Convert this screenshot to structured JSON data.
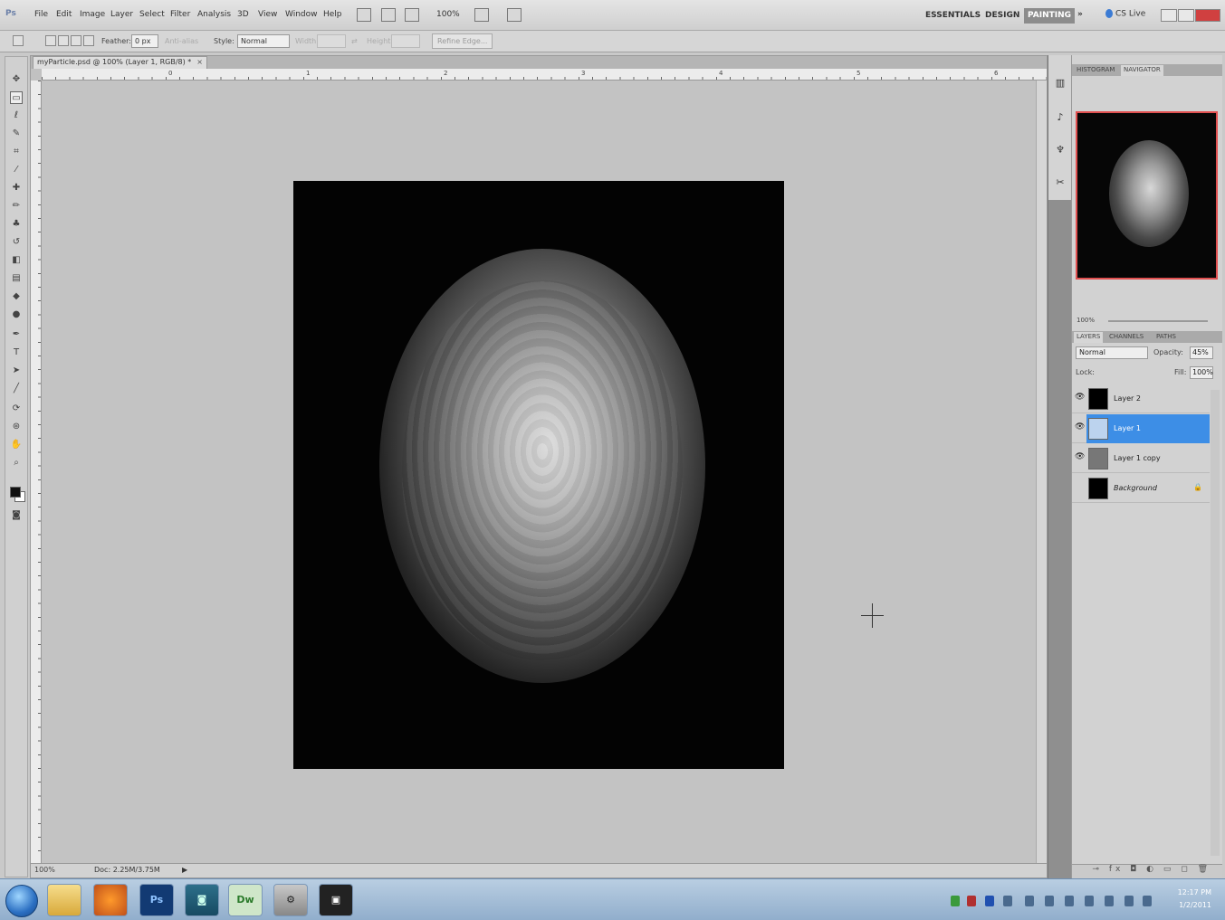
{
  "app": {
    "logo": "Ps",
    "menus": [
      "File",
      "Edit",
      "Image",
      "Layer",
      "Select",
      "Filter",
      "Analysis",
      "3D",
      "View",
      "Window",
      "Help"
    ],
    "zoom_menu": "100%",
    "workspaces": [
      "ESSENTIALS",
      "DESIGN",
      "PAINTING"
    ],
    "active_workspace": "PAINTING",
    "more": "»",
    "cs_live": "CS Live"
  },
  "options": {
    "feather_label": "Feather:",
    "feather_value": "0 px",
    "antialias_label": "Anti-alias",
    "style_label": "Style:",
    "style_value": "Normal",
    "width_label": "Width:",
    "height_label": "Height:",
    "refine_edge": "Refine Edge..."
  },
  "document": {
    "tab_title": "myParticle.psd @ 100% (Layer 1, RGB/8) *",
    "tab_close": "×",
    "ruler_marks": [
      "0",
      "1",
      "2",
      "3",
      "4",
      "5",
      "6",
      "7"
    ],
    "zoom": "100%",
    "status_info": "Doc: 2.25M/3.75M",
    "status_arrow": "▶"
  },
  "panels": {
    "top_tabs": [
      "HISTOGRAM",
      "NAVIGATOR"
    ],
    "active_top_tab": "NAVIGATOR",
    "nav_zoom": "100%",
    "layer_tabs": [
      "LAYERS",
      "CHANNELS",
      "PATHS"
    ],
    "blend_mode": "Normal",
    "opacity_label": "Opacity:",
    "opacity_value": "45%",
    "lock_label": "Lock:",
    "fill_label": "Fill:",
    "fill_value": "100%",
    "bottom_icons": "⊸ fx ◘ ◐ ▭ ◻ 🗑",
    "layers": [
      {
        "name": "Layer 2",
        "selected": false,
        "visible": true,
        "locked": false
      },
      {
        "name": "Layer 1",
        "selected": true,
        "visible": true,
        "locked": false
      },
      {
        "name": "Layer 1 copy",
        "selected": false,
        "visible": true,
        "locked": false
      },
      {
        "name": "Background",
        "selected": false,
        "visible": false,
        "locked": true
      }
    ]
  },
  "taskbar": {
    "apps": [
      "Explorer",
      "Firefox",
      "Ps",
      "Gadget",
      "Dw",
      "Tools",
      "IDE"
    ],
    "time": "12:17 PM",
    "date": "1/2/2011"
  },
  "colors": {
    "accent": "#3d8ee6",
    "canvas_bg": "#030303",
    "navigator_frame": "#e05050"
  }
}
